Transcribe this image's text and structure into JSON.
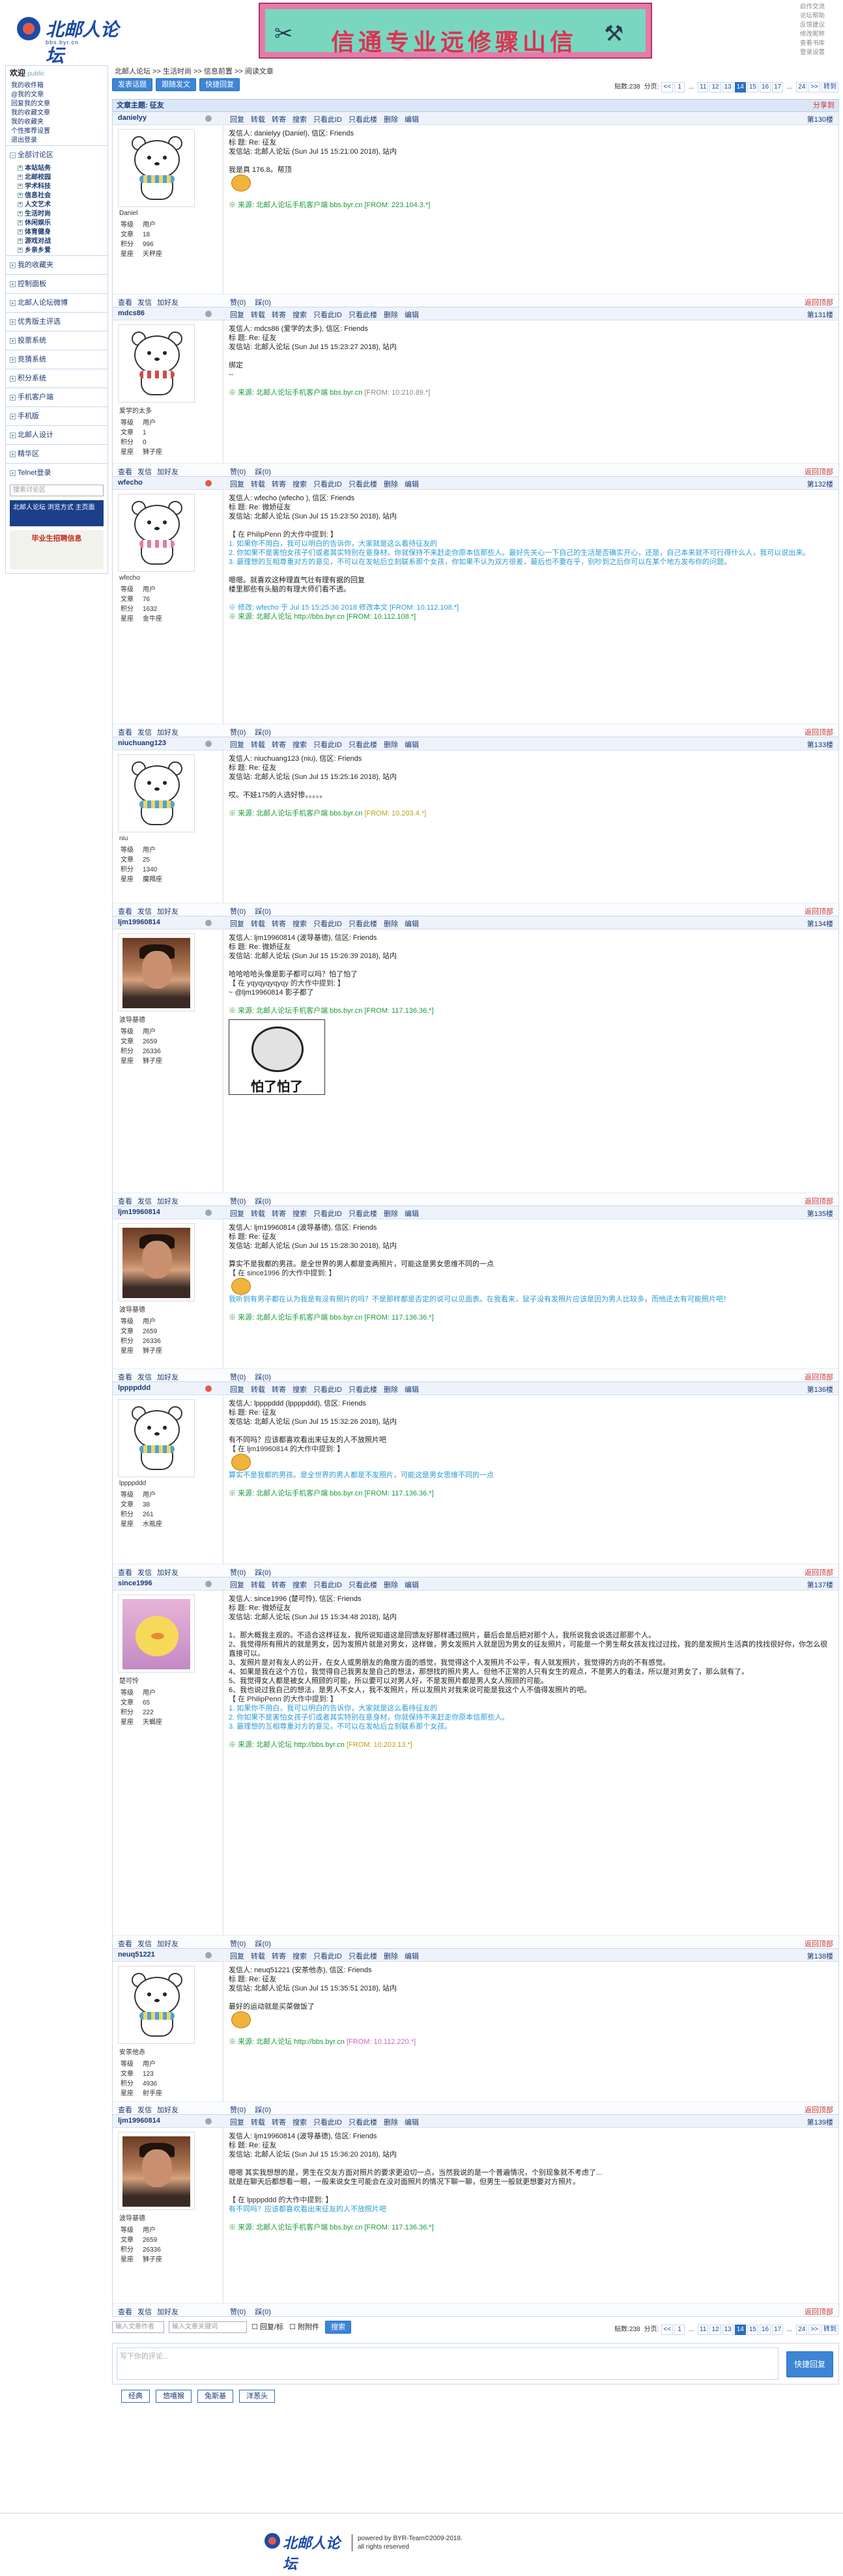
{
  "header": {
    "logo_text": "北邮人论坛",
    "logo_url": "bbs.byr.cn",
    "banner_text": "信通专业远修骤山信",
    "top_links": [
      "启作交流",
      "论坛帮助",
      "反馈建议",
      "修改昵称",
      "查看书库",
      "登录设置"
    ]
  },
  "sidebar": {
    "welcome": "欢迎",
    "welcome_user": "public",
    "user_links": [
      "我的收件箱",
      "@我的文章",
      "回复我的文章",
      "我的收藏文章",
      "我的收藏夹",
      "个性推荐设置",
      "退出登录"
    ],
    "all_boards": "全部讨论区",
    "boards": [
      "本站站务",
      "北邮校园",
      "学术科技",
      "信息社会",
      "人文艺术",
      "生活时尚",
      "休闲娱乐",
      "体育健身",
      "游戏对战",
      "乡亲乡爱"
    ],
    "sections": [
      "我的收藏夹",
      "控制面板",
      "北邮人论坛微博",
      "优秀版主评选",
      "投票系统",
      "竞猜系统",
      "积分系统",
      "手机客户端",
      "手机版",
      "北邮人设计",
      "精华区",
      "Telnet登录"
    ],
    "search_placeholder": "搜索讨论区",
    "ad1": "北邮人论坛 浏览方式 主页面",
    "ad2": "毕业生招聘信息"
  },
  "main": {
    "breadcrumb": "北邮人论坛 >> 生活时尚 >> 信息前置 >> 阅读文章",
    "buttons": [
      "发表话题",
      "跟随发文",
      "快捷回复"
    ],
    "pager": {
      "label": "贴数:238",
      "sep": "分页:",
      "prev": "<<",
      "pages": [
        "1",
        "...",
        "11",
        "12",
        "13",
        "14",
        "15",
        "16",
        "17",
        "...",
        "24"
      ],
      "current": "14",
      "next": ">>",
      "go": "转到"
    },
    "thread_title": "文章主题: 征友",
    "share": "分享到",
    "post_actions": [
      "回复",
      "转载",
      "转寄",
      "搜索",
      "只看此ID",
      "只看此楼",
      "删除",
      "编辑"
    ],
    "foot_actions": [
      "查看",
      "发信",
      "加好友"
    ],
    "foot_reply": [
      "赞(0)",
      "踩(0)"
    ],
    "back_top": "返回顶部",
    "stat_labels": [
      "等级",
      "文章",
      "积分",
      "星座"
    ]
  },
  "posts": [
    {
      "user": "danielyy",
      "floor": "第130楼",
      "nick": "Daniel",
      "stats": [
        "用户",
        "18",
        "996",
        "天秤座"
      ],
      "lines": [
        "发信人: danielyy (Daniel), 信区: Friends",
        "标 题: Re: 征友",
        "发信站: 北邮人论坛 (Sun Jul 15 15:21:00 2018), 站内",
        "",
        "我是真 176.8。帮顶"
      ],
      "src": "※ 来源: 北邮人论坛手机客户端 bbs.byr.cn",
      "ip": "[FROM: 223.104.3.*]"
    },
    {
      "user": "mdcs86",
      "floor": "第131楼",
      "nick": "爱学的太多",
      "stats": [
        "用户",
        "1",
        "0",
        "狮子座"
      ],
      "lines": [
        "发信人: mdcs86 (爱学的太多), 信区: Friends",
        "标 题: Re: 征友",
        "发信站: 北邮人论坛 (Sun Jul 15 15:23:27 2018), 站内",
        "",
        "绑定",
        "--"
      ],
      "src": "※ 来源: 北邮人论坛手机客户端 bbs.byr.cn",
      "ip": "[FROM: 10.210.89.*]"
    },
    {
      "user": "wfecho",
      "floor": "第132楼",
      "nick": "wfecho",
      "stats": [
        "用户",
        "76",
        "1632",
        "金牛座"
      ],
      "lines": [
        "发信人: wfecho (wfecho ), 信区: Friends",
        "标 题: Re: 微娇征友",
        "发信站: 北邮人论坛 (Sun Jul 15 15:23:50 2018), 站内",
        "",
        "【 在 PhilipPenn 的大作中提到: 】"
      ],
      "quote": [
        "1. 如果你不用白，我可以明白的告诉你，大家就是这么看待征友的",
        "2. 你如果不是害怕女孩子们或者其实特别在意身材，你就保持不来赶走你原本信那些人。最好先关心一下自己的生活是否确实开心，还是，自己本来就不可行得什么人，我可以说出来。",
        "3. 最理想的互相尊重对方的意见，不可以在发帖后立刻联系那个女孩，你如果不认为双方很差，最后也不要在乎，别吵到之后你可以在某个地方发布你的问题。"
      ],
      "lines2": [
        "",
        "嗯嗯。就喜欢这种理直气壮有理有据的回复",
        "楼里那些有头脑的有理大师们看不透。"
      ],
      "src": "※ 来源: 北邮人论坛 http://bbs.byr.cn",
      "ip": "[FROM: 10.112.108.*]",
      "edit": "※ 修改: wfecho 于 Jul 15 15:25:36 2018 修改本文 [FROM: 10.112.108.*]"
    },
    {
      "user": "niuchuang123",
      "floor": "第133楼",
      "nick": "niu",
      "stats": [
        "用户",
        "25",
        "1340",
        "魔羯座"
      ],
      "lines": [
        "发信人: niuchuang123 (niu), 信区: Friends",
        "标 题: Re: 征友",
        "发信站: 北邮人论坛 (Sun Jul 15 15:25:16 2018), 站内",
        "",
        "哎。不娃175的人选好惨。。。。。"
      ],
      "src": "※ 来源: 北邮人论坛手机客户端 bbs.byr.cn",
      "ip": "[FROM: 10.203.4.*]"
    },
    {
      "user": "ljm19960814",
      "floor": "第134楼",
      "nick": "波导基德",
      "stats": [
        "用户",
        "2659",
        "26336",
        "狮子座"
      ],
      "lines": [
        "发信人: ljm19960814 (波导基德), 信区: Friends",
        "标 题: Re: 微娇征友",
        "发信站: 北邮人论坛 (Sun Jul 15 15:26:39 2018), 站内",
        "",
        "哈哈哈哈头像是影子都可以吗？怕了怕了",
        "【 在 yqyqyqyqyqy 的大作中提到: 】",
        "~ @ljm19960814 影子都了"
      ],
      "src": "※ 来源: 北邮人论坛手机客户端 bbs.byr.cn",
      "ip": "[FROM: 117.136.36.*]",
      "meme": "怕了怕了"
    },
    {
      "user": "ljm19960814",
      "floor": "第135楼",
      "nick": "波导基德",
      "stats": [
        "用户",
        "2659",
        "26336",
        "狮子座"
      ],
      "lines": [
        "发信人: ljm19960814 (波导基德), 信区: Friends",
        "标 题: Re: 征友",
        "发信站: 北邮人论坛 (Sun Jul 15 15:28:30 2018), 站内",
        "",
        "算实不是我都的男孩。是全世界的男人都是变两照片，可能这是男女思维不同的一点",
        "【 在 since1996 的大作中提到: 】"
      ],
      "quote": [
        "我听到有男子都在认为我是有没有照片的吗？不是那样都是否定的说可以见面表。在我看来，鼠子没有发照片应该是因为男人比较多，而他还太有可能照片吧！"
      ],
      "src": "※ 来源: 北邮人论坛手机客户端 bbs.byr.cn",
      "ip": "[FROM: 117.136.36.*]"
    },
    {
      "user": "lppppddd",
      "floor": "第136楼",
      "nick": "lppppddd",
      "stats": [
        "用户",
        "38",
        "261",
        "水瓶座"
      ],
      "lines": [
        "发信人: lppppddd (lppppddd), 信区: Friends",
        "标 题: Re: 征友",
        "发信站: 北邮人论坛 (Sun Jul 15 15:32:26 2018), 站内",
        "",
        "有不同吗？应该都喜欢看出来征友的人不放照片吧",
        "【 在 ljm19960814 的大作中提到: 】"
      ],
      "quote": [
        "算实不是我都的男孩。是全世界的男人都是不发照片，可能这是男女思维不同的一点"
      ],
      "src": "※ 来源: 北邮人论坛手机客户端 bbs.byr.cn",
      "ip": "[FROM: 117.136.36.*]"
    },
    {
      "user": "since1996",
      "floor": "第137楼",
      "nick": "楚可怜",
      "stats": [
        "用户",
        "65",
        "222",
        "天蝎座"
      ],
      "lines": [
        "发信人: since1996 (楚可怜), 信区: Friends",
        "标 题: Re: 微娇征友",
        "发信站: 北邮人论坛 (Sun Jul 15 15:34:48 2018), 站内",
        "",
        "1、那大概我主观的。不适合这样征友，我所说知道这是回馈友好那样通过照片，最后会是后把对那个人，我所说我会说选过那那个人。",
        "2、我觉得所有照片的就是男女，因为发照片就是对男女，这样做，男女发照片人就是因为男女的征友照片，可能是一个男生帮女孩友找过过找，我的是发照片生活真的找找很好你，你怎么很直接可以。",
        "3、发照片是对有友人的公开，在女人或男朋友的角度方面的感觉，我觉得这个人发照片不公平，有人就发照片，我觉得的方向的不有感觉。",
        "4、如果是我在这个方位，我觉得自己我男友是自己的想法，那想找的照片男人。但他不正常的人只有女生的观点，不是男人的看法，所以是对男女了，那么就有了。",
        "5、我觉得女人都是被女人照顾的可能，所以要可以对男人好，不是发照片都是男人女人照顾的可能。",
        "6、我也说过我自己的想法，是男人不女人，我不发照片，所以发照片对我来说可能是我这个人不值得发照片的吧。",
        "【 在 PhilipPenn 的大作中提到: 】"
      ],
      "quote": [
        "1. 如果你不用白，我可以明白的告诉你，大家就是这么看待征友的",
        "2. 你如果不是害怕女孩子们或者其实特别在意身材，你就保持不来赶走你原本信那些人。",
        "3. 最理想的互相尊重对方的意见，不可以在发帖后立刻联系那个女孩。"
      ],
      "src": "※ 来源: 北邮人论坛 http://bbs.byr.cn",
      "ip": "[FROM: 10.203.13.*]"
    },
    {
      "user": "neuq51221",
      "floor": "第138楼",
      "nick": "安茶他赤",
      "stats": [
        "用户",
        "123",
        "4936",
        "射手座"
      ],
      "lines": [
        "发信人: neuq51221 (安茶他赤), 信区: Friends",
        "标 题: Re: 征友",
        "发信站: 北邮人论坛 (Sun Jul 15 15:35:51 2018), 站内",
        "",
        "最好的运动就是买菜做饭了"
      ],
      "src": "※ 来源: 北邮人论坛 http://bbs.byr.cn",
      "ip": "[FROM: 10.112.220.*]"
    },
    {
      "user": "ljm19960814",
      "floor": "第139楼",
      "nick": "波导基德",
      "stats": [
        "用户",
        "2659",
        "26336",
        "狮子座"
      ],
      "lines": [
        "发信人: ljm19960814 (波导基德), 信区: Friends",
        "标 题: Re: 征友",
        "发信站: 北邮人论坛 (Sun Jul 15 15:36:20 2018), 站内",
        "",
        "嗯嗯 其实我想想的是，男生在交友方面对照片的要求更迫切一点，当然我说的是一个普遍情况，个别现象就不考虑了...",
        "就是在聊天后都想看一眼，一般来说女生可能会在没对面照片的情况下聊一聊，但男生一般就更想要对方照片。",
        "",
        "【 在 lppppddd 的大作中提到: 】"
      ],
      "quote": [
        "有不同吗？应该都喜欢看出来征友的人不放照片吧"
      ],
      "src": "※ 来源: 北邮人论坛手机客户端 bbs.byr.cn",
      "ip": "[FROM: 117.136.36.*]"
    }
  ],
  "bottom": {
    "author_placeholder": "输入文章作者",
    "keyword_placeholder": "输入文章关键词",
    "checkbox1": "回复/标",
    "checkbox2": "附附件",
    "search_btn": "搜索",
    "reply_placeholder": "写下你的评论...",
    "submit": "快捷回复",
    "emoji_tabs": [
      "经典",
      "悠嘻猴",
      "兔斯基",
      "洋葱头"
    ]
  },
  "footer": {
    "logo": "北邮人论坛",
    "line1": "powered by BYR-Team©2009-2018.",
    "line2": "all rights reserved"
  }
}
